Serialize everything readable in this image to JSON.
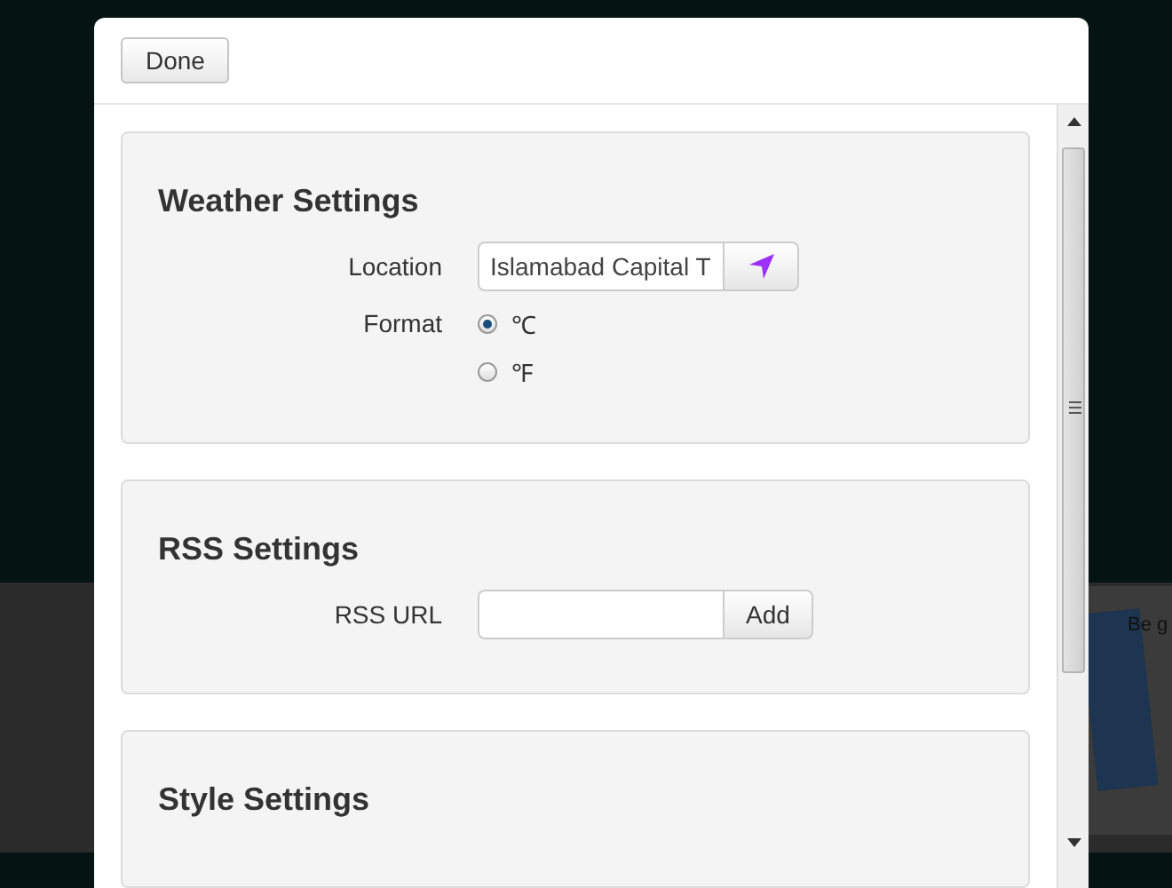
{
  "background": {
    "card_text": "Be g"
  },
  "dialog": {
    "done_button": "Done"
  },
  "sections": [
    {
      "title": "Weather Settings",
      "rows": [
        {
          "kind": "location",
          "label": "Location",
          "value": "Islamabad Capital T"
        },
        {
          "kind": "radio",
          "label": "Format",
          "options": [
            {
              "label": "℃",
              "selected": true
            },
            {
              "label": "℉",
              "selected": false
            }
          ]
        }
      ]
    },
    {
      "title": "RSS Settings",
      "rows": [
        {
          "kind": "url",
          "label": "RSS URL",
          "button": "Add"
        }
      ]
    },
    {
      "title": "Style Settings"
    }
  ]
}
